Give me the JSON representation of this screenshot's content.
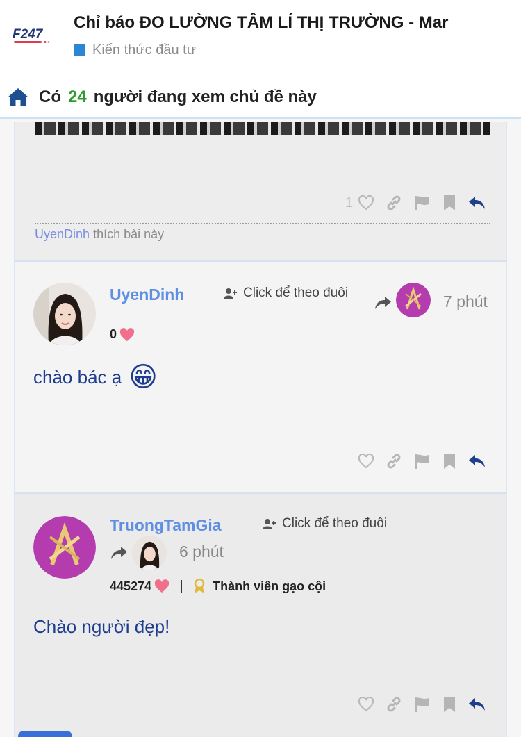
{
  "header": {
    "logo_text": "F247",
    "thread_title": "Chỉ báo ĐO LƯỜNG TÂM LÍ THỊ TRƯỜNG - Mar",
    "forum": "Kiến thức đầu tư"
  },
  "viewers": {
    "prefix": "Có",
    "count": "24",
    "suffix": "người đang xem chủ đề này"
  },
  "posts": [
    {
      "like_count": "1",
      "liked_by_user": "UyenDinh",
      "liked_by_text": "thích bài này"
    },
    {
      "username": "UyenDinh",
      "follow_label": "Click để theo đuôi",
      "time": "7 phút",
      "points": "0",
      "body": "chào bác ạ",
      "emoji": "😁"
    },
    {
      "username": "TruongTamGia",
      "follow_label": "Click để theo đuôi",
      "time": "6 phút",
      "points": "445274",
      "rank": "Thành viên gạo cội",
      "body": "Chào người đẹp!"
    }
  ],
  "icons": {
    "home": "home-icon",
    "like": "heart-icon",
    "link": "link-icon",
    "flag": "flag-icon",
    "bookmark": "bookmark-icon",
    "reply": "reply-icon",
    "follow": "person-add-icon"
  },
  "colors": {
    "accent": "#5f8fe3",
    "navy": "#1f3d8f",
    "green": "#2e9b2e",
    "heart": "#f06f8a",
    "logo_red": "#e03a4b"
  }
}
